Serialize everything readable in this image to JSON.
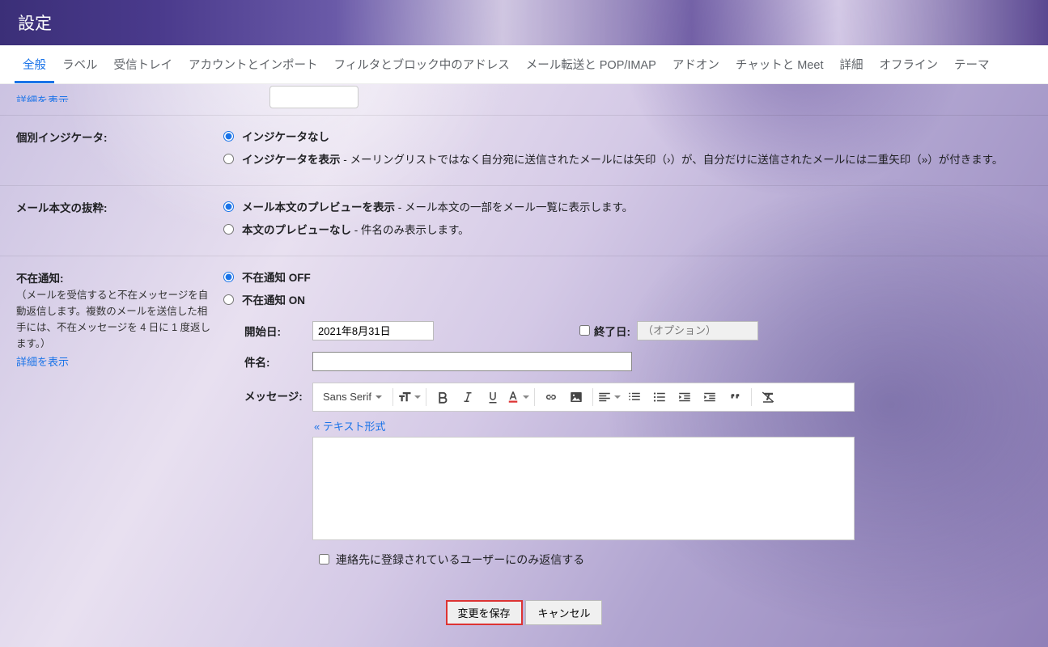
{
  "header": {
    "title": "設定"
  },
  "tabs": [
    "全般",
    "ラベル",
    "受信トレイ",
    "アカウントとインポート",
    "フィルタとブロック中のアドレス",
    "メール転送と POP/IMAP",
    "アドオン",
    "チャットと Meet",
    "詳細",
    "オフライン",
    "テーマ"
  ],
  "activeTab": 0,
  "truncated": {
    "link": "詳細を表示"
  },
  "indicators": {
    "label": "個別インジケータ:",
    "option_none": "インジケータなし",
    "option_show": "インジケータを表示",
    "option_show_desc": " - メーリングリストではなく自分宛に送信されたメールには矢印（›）が、自分だけに送信されたメールには二重矢印（»）が付きます。"
  },
  "snippets": {
    "label": "メール本文の抜粋:",
    "option_show": "メール本文のプレビューを表示",
    "option_show_desc": " - メール本文の一部をメール一覧に表示します。",
    "option_none": "本文のプレビューなし",
    "option_none_desc": " - 件名のみ表示します。"
  },
  "vacation": {
    "label": "不在通知:",
    "desc": "（メールを受信すると不在メッセージを自動返信します。複数のメールを送信した相手には、不在メッセージを 4 日に 1 度返します。）",
    "detail_link": "詳細を表示",
    "off": "不在通知 OFF",
    "on": "不在通知 ON",
    "start_label": "開始日:",
    "start_value": "2021年8月31日",
    "end_label": "終了日:",
    "end_placeholder": "（オプション）",
    "subject_label": "件名:",
    "message_label": "メッセージ:",
    "font": "Sans Serif",
    "plain_link": "« テキスト形式",
    "contacts_only": "連絡先に登録されているユーザーにのみ返信する"
  },
  "buttons": {
    "save": "変更を保存",
    "cancel": "キャンセル"
  }
}
